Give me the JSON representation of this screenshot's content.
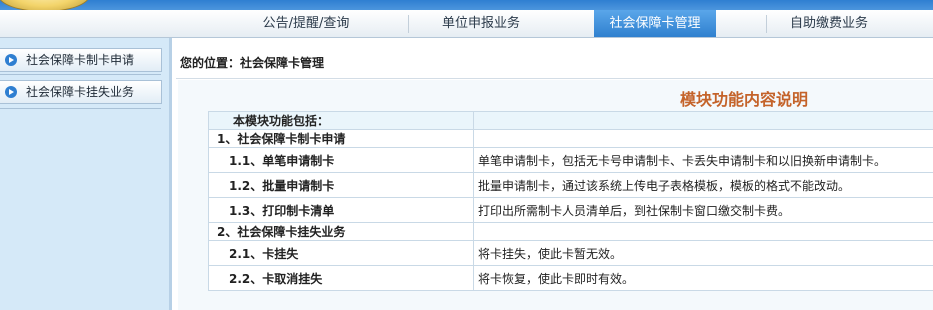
{
  "nav": {
    "items": [
      {
        "label": "公告/提醒/查询",
        "active": false
      },
      {
        "label": "单位申报业务",
        "active": false
      },
      {
        "label": "社会保障卡管理",
        "active": true
      },
      {
        "label": "自助缴费业务",
        "active": false
      }
    ]
  },
  "sidebar": {
    "items": [
      {
        "label": "社会保障卡制卡申请",
        "icon": "play-circle-icon"
      },
      {
        "label": "社会保障卡挂失业务",
        "icon": "play-circle-icon"
      }
    ]
  },
  "breadcrumb": {
    "text": "您的位置：社会保障卡管理"
  },
  "module": {
    "title": "模块功能内容说明",
    "table_header": "本模块功能包括：",
    "sections": [
      {
        "label": "1、社会保障卡制卡申请",
        "items": [
          {
            "label": "1.1、单笔申请制卡",
            "desc": "单笔申请制卡，包括无卡号申请制卡、卡丢失申请制卡和以旧换新申请制卡。"
          },
          {
            "label": "1.2、批量申请制卡",
            "desc": "批量申请制卡，通过该系统上传电子表格模板，模板的格式不能改动。"
          },
          {
            "label": "1.3、打印制卡清单",
            "desc": "打印出所需制卡人员清单后，到社保制卡窗口缴交制卡费。"
          }
        ]
      },
      {
        "label": "2、社会保障卡挂失业务",
        "items": [
          {
            "label": "2.1、卡挂失",
            "desc": "将卡挂失，使此卡暂无效。"
          },
          {
            "label": "2.2、卡取消挂失",
            "desc": "将卡恢复，使此卡即时有效。"
          }
        ]
      }
    ]
  },
  "colors": {
    "accent": "#2f80cf",
    "highlight_text": "#c4632a",
    "sidebar_bg": "#d5e9f8"
  }
}
